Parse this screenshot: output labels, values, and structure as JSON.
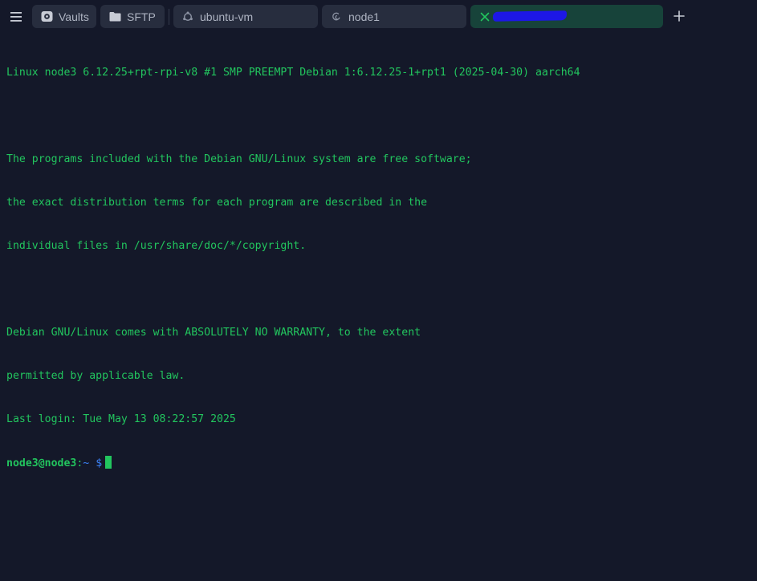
{
  "tabs": [
    {
      "label": "Vaults",
      "icon": "vault-icon"
    },
    {
      "label": "SFTP",
      "icon": "folder-icon"
    },
    {
      "label": "ubuntu-vm",
      "icon": "ubuntu-icon"
    },
    {
      "label": "node1",
      "icon": "debian-icon"
    },
    {
      "label": "",
      "icon": "close-icon",
      "active": true
    }
  ],
  "terminal": {
    "lines": [
      "Linux node3 6.12.25+rpt-rpi-v8 #1 SMP PREEMPT Debian 1:6.12.25-1+rpt1 (2025-04-30) aarch64",
      "",
      "The programs included with the Debian GNU/Linux system are free software;",
      "the exact distribution terms for each program are described in the",
      "individual files in /usr/share/doc/*/copyright.",
      "",
      "Debian GNU/Linux comes with ABSOLUTELY NO WARRANTY, to the extent",
      "permitted by applicable law.",
      "Last login: Tue May 13 08:22:57 2025"
    ],
    "prompt": {
      "user_host": "node3@node3",
      "separator": ":",
      "path": "~",
      "symbol": "$"
    }
  },
  "colors": {
    "background": "#141829",
    "tab": "#272d3e",
    "active_tab": "#17433a",
    "terminal_text": "#22c55e",
    "prompt_path": "#3b82f6"
  }
}
